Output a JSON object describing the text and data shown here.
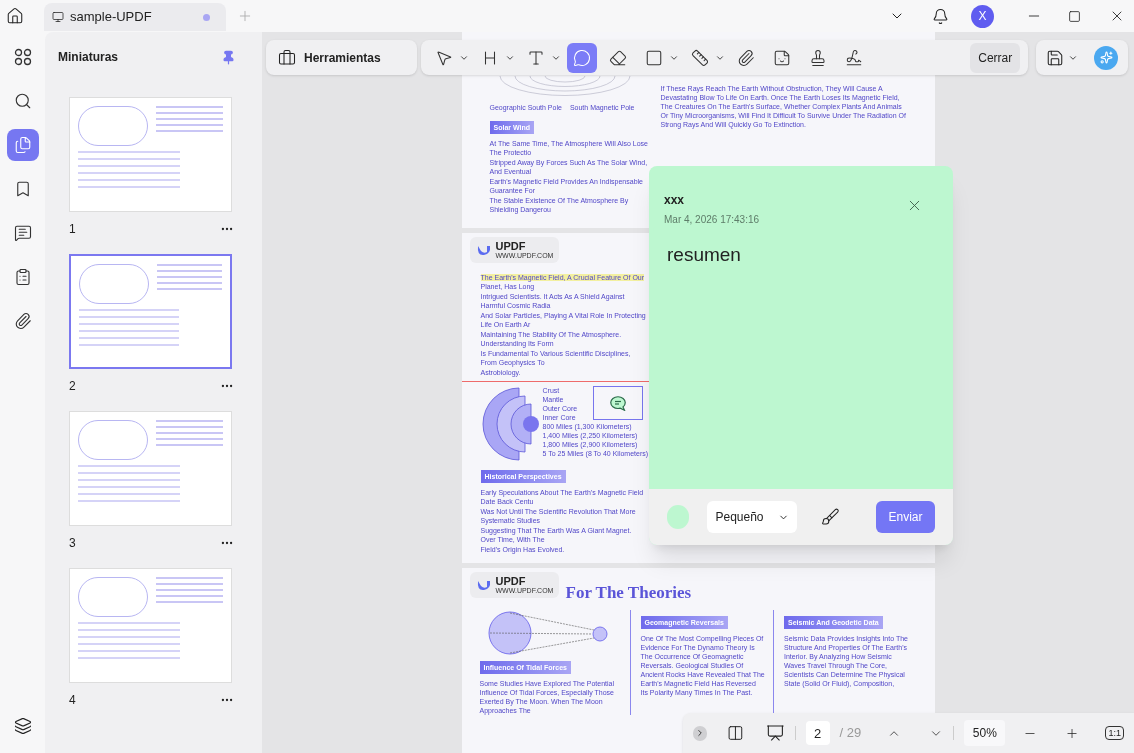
{
  "tab": {
    "title": "sample-UPDF",
    "modified": true
  },
  "account": {
    "initial": "X"
  },
  "rail": [
    {
      "kind": "grid",
      "selected": false
    },
    {
      "kind": "search",
      "selected": false
    },
    {
      "kind": "pages",
      "selected": true
    },
    {
      "kind": "bookmark",
      "selected": false
    },
    {
      "kind": "comments",
      "selected": false
    },
    {
      "kind": "forms",
      "selected": false
    },
    {
      "kind": "attachments",
      "selected": false
    }
  ],
  "thumbnails": {
    "title": "Miniaturas",
    "pages": [
      {
        "label": "1",
        "selected": false
      },
      {
        "label": "2",
        "selected": true
      },
      {
        "label": "3",
        "selected": false
      },
      {
        "label": "4",
        "selected": false
      }
    ]
  },
  "toolbar": {
    "tools_button": "Herramientas",
    "tools": [
      {
        "kind": "select",
        "caret": true,
        "selected": false
      },
      {
        "kind": "heading",
        "caret": true,
        "selected": false
      },
      {
        "kind": "text",
        "caret": true,
        "selected": false
      },
      {
        "kind": "comment",
        "caret": false,
        "selected": true
      },
      {
        "kind": "eraser",
        "caret": false,
        "selected": false
      },
      {
        "kind": "shape",
        "caret": true,
        "selected": false
      },
      {
        "kind": "measure",
        "caret": true,
        "selected": false
      },
      {
        "kind": "attach",
        "caret": false,
        "selected": false
      },
      {
        "kind": "sticker",
        "caret": false,
        "selected": false
      },
      {
        "kind": "stamp",
        "caret": false,
        "selected": false
      },
      {
        "kind": "signature",
        "caret": false,
        "selected": false
      }
    ],
    "close": "Cerrar"
  },
  "page_1": {
    "diagram_labels": [
      "Geographic South Pole",
      "South Magnetic Pole"
    ],
    "right_paragraph": "If These Rays Reach The Earth Without Obstruction, They Will Cause A Devastating Blow To Life On Earth. Once The Earth Loses Its Magnetic Field, The Creatures On The Earth's Surface, Whether Complex Plants And Animals Or Tiny Microorganisms, Will Find It Difficult To Survive Under The Radiation Of Strong Rays And Will Quickly Go To Extinction.",
    "tag": "Solar Wind",
    "lines": [
      "At The Same Time, The Atmosphere Will Also Lose The Protectio",
      "Stripped Away By Forces Such As The Solar Wind, And Eventual",
      "Earth's Magnetic Field Provides An Indispensable Guarantee For",
      "The Stable Existence Of The Atmosphere By Shielding Dangerou"
    ]
  },
  "page_2": {
    "logo": "UPDF",
    "logo_url": "WWW.UPDF.COM",
    "lines": [
      [
        {
          "text": "The Earth's Magnetic Field, A Crucial Feature Of Our",
          "highlighted": true
        },
        {
          "text": " Planet, Has Long",
          "highlighted": false
        }
      ],
      [
        {
          "text": "Intrigued Scientists. It Acts As A Shield Against Harmful Cosmic Radia",
          "highlighted": false
        }
      ],
      [
        {
          "text": "And Solar Particles, Playing A Vital Role In Protecting Life On Earth Ar",
          "highlighted": false
        }
      ],
      [
        {
          "text": "Maintaining The Stability Of The Atmosphere. Understanding Its Form",
          "highlighted": false
        }
      ],
      [
        {
          "text": "Is Fundamental To Various Scientific Disciplines, From Geophysics To",
          "highlighted": false
        }
      ],
      [
        {
          "text": "Astrobiology.",
          "highlighted": false
        }
      ]
    ],
    "layers": [
      "Crust",
      "Mantle",
      "Outer Core",
      "Inner Core"
    ],
    "distances": [
      "800 Miles (1,300 Kilometers)",
      "1,400 Miles (2,250 Kilometers)",
      "1,800 Miles (2,900 Kilometers)",
      "5 To 25 Miles (8 To 40 Kilometers)"
    ],
    "tag": "Historical Perspectives",
    "lines_2": [
      "Early Speculations About The Earth's Magnetic Field Date Back Centu",
      "Was Not Until The Scientific Revolution That More Systematic Studies",
      "Suggesting That The Earth Was A Giant Magnet. Over Time, With The",
      "Field's Origin Has Evolved."
    ]
  },
  "page_3": {
    "logo": "UPDF",
    "logo_url": "WWW.UPDF.COM",
    "title": "For The Theories",
    "columns": [
      {
        "tag": "Influence Of Tidal Forces",
        "text": "Some Studies Have Explored The Potential Influence Of Tidal Forces, Especially Those Exerted By The Moon. When The Moon Approaches The"
      },
      {
        "tag": "Geomagnetic Reversals",
        "text": "One Of The Most Compelling Pieces Of Evidence For The Dynamo Theory Is The Occurrence Of Geomagnetic Reversals. Geological Studies Of Ancient Rocks Have Revealed That The Earth's Magnetic Field Has Reversed Its Polarity Many Times In The Past."
      },
      {
        "tag": "Seismic And Geodetic Data",
        "text": "Seismic Data Provides Insights Into The Structure And Properties Of The Earth's Interior. By Analyzing How Seismic Waves Travel Through The Core, Scientists Can Determine The Physical State (Solid Or Fluid), Composition,"
      }
    ]
  },
  "note": {
    "author": "xxx",
    "date": "Mar 4, 2026 17:43:16",
    "value": "resumen",
    "color": "#bdf7d0",
    "size": "Pequeño",
    "send": "Enviar"
  },
  "bottom_bar": {
    "page": "2",
    "total": "/ 29",
    "zoom": "50%",
    "actual_size": "1:1"
  }
}
